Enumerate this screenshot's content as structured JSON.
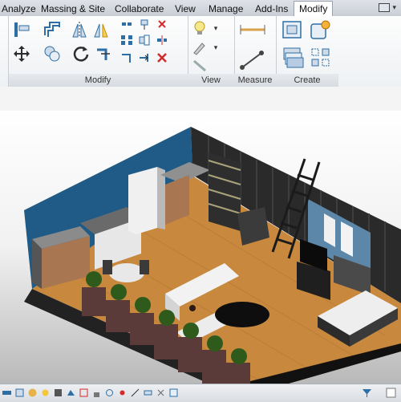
{
  "tabs": [
    {
      "label": "Analyze",
      "active": false
    },
    {
      "label": "Massing & Site",
      "active": false
    },
    {
      "label": "Collaborate",
      "active": false
    },
    {
      "label": "View",
      "active": false
    },
    {
      "label": "Manage",
      "active": false
    },
    {
      "label": "Add-Ins",
      "active": false
    },
    {
      "label": "Modify",
      "active": true
    }
  ],
  "ribbon": {
    "panels": [
      {
        "title": "Modify"
      },
      {
        "title": "View"
      },
      {
        "title": "Measure"
      },
      {
        "title": "Create"
      }
    ]
  },
  "colors": {
    "accent": "#2d6ea6",
    "wall_blue": "#1f5b86",
    "floor_wood": "#c8893e",
    "delete_red": "#d22b2b"
  }
}
